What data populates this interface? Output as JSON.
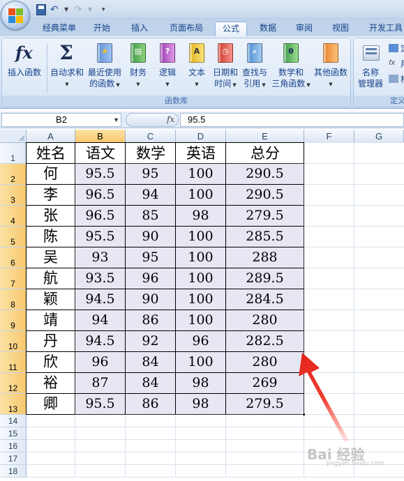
{
  "quick_access": {
    "icons": [
      "save-icon",
      "undo-icon",
      "redo-icon",
      "customize-icon"
    ]
  },
  "tabs": [
    {
      "label": "经典菜单"
    },
    {
      "label": "开始"
    },
    {
      "label": "插入"
    },
    {
      "label": "页面布局"
    },
    {
      "label": "公式",
      "active": true
    },
    {
      "label": "数据"
    },
    {
      "label": "审阅"
    },
    {
      "label": "视图"
    },
    {
      "label": "开发工具"
    }
  ],
  "ribbon": {
    "insert_function": {
      "label": "插入函数",
      "glyph": "fx"
    },
    "autosum": {
      "label": "自动求和",
      "glyph": "Σ"
    },
    "recent": {
      "label1": "最近使用",
      "label2": "的函数"
    },
    "financial": {
      "label": "财务"
    },
    "logical": {
      "label": "逻辑"
    },
    "text": {
      "label": "文本"
    },
    "datetime": {
      "label1": "日期和",
      "label2": "时间"
    },
    "lookup": {
      "label1": "查找与",
      "label2": "引用"
    },
    "math": {
      "label1": "数学和",
      "label2": "三角函数"
    },
    "more": {
      "label": "其他函数"
    },
    "group_funclib": "函数库",
    "name_manager": {
      "label1": "名称",
      "label2": "管理器"
    },
    "defined_items": [
      "定",
      "用",
      "根"
    ],
    "group_defined": "定义"
  },
  "formula_bar": {
    "name_box": "B2",
    "fx": "fx",
    "value": "95.5"
  },
  "sheet": {
    "columns": [
      "A",
      "B",
      "C",
      "D",
      "E",
      "F",
      "G"
    ],
    "rows": [
      "1",
      "2",
      "3",
      "4",
      "5",
      "6",
      "7",
      "8",
      "9",
      "10",
      "11",
      "12",
      "13",
      "14",
      "15",
      "16",
      "17",
      "18"
    ],
    "headers": [
      "姓名",
      "语文",
      "数学",
      "英语",
      "总分"
    ],
    "data": [
      [
        "何",
        "95.5",
        "95",
        "100",
        "290.5"
      ],
      [
        "李",
        "96.5",
        "94",
        "100",
        "290.5"
      ],
      [
        "张",
        "96.5",
        "85",
        "98",
        "279.5"
      ],
      [
        "陈",
        "95.5",
        "90",
        "100",
        "285.5"
      ],
      [
        "吴",
        "93",
        "95",
        "100",
        "288"
      ],
      [
        "航",
        "93.5",
        "96",
        "100",
        "289.5"
      ],
      [
        "颖",
        "94.5",
        "90",
        "100",
        "284.5"
      ],
      [
        "靖",
        "94",
        "86",
        "100",
        "280"
      ],
      [
        "丹",
        "94.5",
        "92",
        "96",
        "282.5"
      ],
      [
        "欣",
        "96",
        "84",
        "100",
        "280"
      ],
      [
        "裕",
        "87",
        "84",
        "98",
        "269"
      ],
      [
        "卿",
        "95.5",
        "86",
        "98",
        "279.5"
      ]
    ]
  },
  "watermark": {
    "text": "Bai 经验",
    "sub": "jingyan.baidu.com"
  },
  "colors": {
    "accent_arrow": "#e8352b",
    "selection_header": "#f8c76e",
    "cell_fill": "#e7e7f3"
  }
}
